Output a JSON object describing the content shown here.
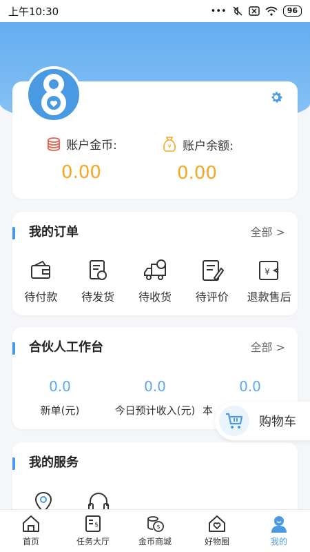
{
  "status_bar": {
    "time": "上午10:30",
    "battery": "96"
  },
  "account": {
    "coins_label": "账户金币:",
    "coins_value": "0.00",
    "balance_label": "账户余额:",
    "balance_value": "0.00"
  },
  "orders": {
    "title": "我的订单",
    "more": "全部 >",
    "items": [
      {
        "label": "待付款",
        "icon": "wallet-icon"
      },
      {
        "label": "待发货",
        "icon": "shipping-doc-icon"
      },
      {
        "label": "待收货",
        "icon": "truck-icon"
      },
      {
        "label": "待评价",
        "icon": "review-icon"
      },
      {
        "label": "退款售后",
        "icon": "refund-icon"
      }
    ]
  },
  "partner": {
    "title": "合伙人工作台",
    "more": "全部 >",
    "stats": [
      {
        "value": "0.0",
        "label": "新单(元)"
      },
      {
        "value": "0.0",
        "label": "今日预计收入(元)"
      },
      {
        "value": "0.0",
        "label": "本"
      }
    ]
  },
  "cart": {
    "label": "购物车"
  },
  "services": {
    "title": "我的服务",
    "items": [
      {
        "icon": "location-icon"
      },
      {
        "icon": "headset-icon"
      }
    ]
  },
  "tabbar": {
    "items": [
      {
        "label": "首页",
        "icon": "home-icon"
      },
      {
        "label": "任务大厅",
        "icon": "task-icon"
      },
      {
        "label": "金币商城",
        "icon": "coin-mall-icon"
      },
      {
        "label": "好物圈",
        "icon": "good-things-icon"
      },
      {
        "label": "我的",
        "icon": "profile-icon"
      }
    ],
    "active_index": 4
  },
  "colors": {
    "accent": "#4a9ae3",
    "amount": "#f5a623"
  }
}
